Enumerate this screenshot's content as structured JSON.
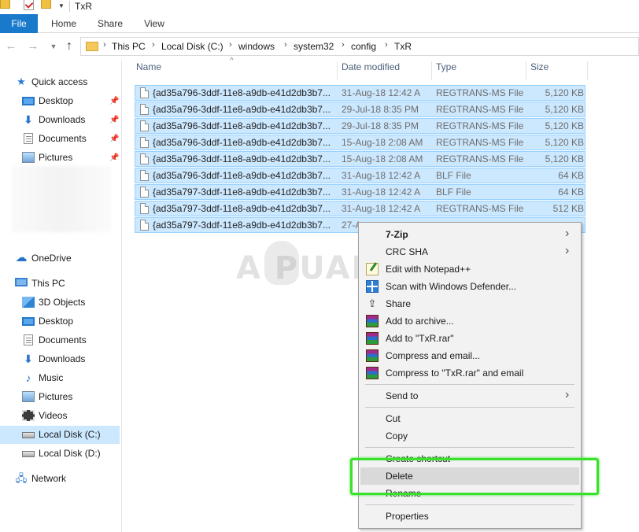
{
  "window": {
    "title": "TxR"
  },
  "ribbon": {
    "tabs": [
      "File",
      "Home",
      "Share",
      "View"
    ]
  },
  "address": {
    "parts": [
      "This PC",
      "Local Disk (C:)",
      "windows",
      "system32",
      "config",
      "TxR"
    ]
  },
  "nav": {
    "quick_access": "Quick access",
    "quick_items": [
      "Desktop",
      "Downloads",
      "Documents",
      "Pictures"
    ],
    "onedrive": "OneDrive",
    "this_pc": "This PC",
    "pc_items": [
      "3D Objects",
      "Desktop",
      "Documents",
      "Downloads",
      "Music",
      "Pictures",
      "Videos",
      "Local Disk (C:)",
      "Local Disk (D:)"
    ],
    "network": "Network"
  },
  "list": {
    "headers": {
      "name": "Name",
      "date": "Date modified",
      "type": "Type",
      "size": "Size"
    },
    "rows": [
      {
        "name": "{ad35a796-3ddf-11e8-a9db-e41d2db3b7...",
        "date": "31-Aug-18 12:42 A",
        "type": "REGTRANS-MS File",
        "size": "5,120 KB"
      },
      {
        "name": "{ad35a796-3ddf-11e8-a9db-e41d2db3b7...",
        "date": "29-Jul-18 8:35 PM",
        "type": "REGTRANS-MS File",
        "size": "5,120 KB"
      },
      {
        "name": "{ad35a796-3ddf-11e8-a9db-e41d2db3b7...",
        "date": "29-Jul-18 8:35 PM",
        "type": "REGTRANS-MS File",
        "size": "5,120 KB"
      },
      {
        "name": "{ad35a796-3ddf-11e8-a9db-e41d2db3b7...",
        "date": "15-Aug-18 2:08 AM",
        "type": "REGTRANS-MS File",
        "size": "5,120 KB"
      },
      {
        "name": "{ad35a796-3ddf-11e8-a9db-e41d2db3b7...",
        "date": "15-Aug-18 2:08 AM",
        "type": "REGTRANS-MS File",
        "size": "5,120 KB"
      },
      {
        "name": "{ad35a796-3ddf-11e8-a9db-e41d2db3b7...",
        "date": "31-Aug-18 12:42 A",
        "type": "BLF File",
        "size": "64 KB"
      },
      {
        "name": "{ad35a797-3ddf-11e8-a9db-e41d2db3b7...",
        "date": "31-Aug-18 12:42 A",
        "type": "BLF File",
        "size": "64 KB"
      },
      {
        "name": "{ad35a797-3ddf-11e8-a9db-e41d2db3b7...",
        "date": "31-Aug-18 12:42 A",
        "type": "REGTRANS-MS File",
        "size": "512 KB"
      },
      {
        "name": "{ad35a797-3ddf-11e8-a9db-e41d2db3b7...",
        "date": "27-A",
        "type": "",
        "size": ""
      }
    ]
  },
  "context_menu": {
    "items": [
      {
        "label": "7-Zip",
        "bold": true,
        "submenu": true,
        "icon": ""
      },
      {
        "label": "CRC SHA",
        "submenu": true,
        "icon": ""
      },
      {
        "label": "Edit with Notepad++",
        "icon": "notepadpp-icon"
      },
      {
        "label": "Scan with Windows Defender...",
        "icon": "defender-icon"
      },
      {
        "label": "Share",
        "icon": "share-icon"
      },
      {
        "label": "Add to archive...",
        "icon": "winrar-icon"
      },
      {
        "label": "Add to \"TxR.rar\"",
        "icon": "winrar-icon"
      },
      {
        "label": "Compress and email...",
        "icon": "winrar-icon"
      },
      {
        "label": "Compress to \"TxR.rar\" and email",
        "icon": "winrar-icon"
      },
      {
        "label": "Send to",
        "submenu": true,
        "icon": ""
      },
      {
        "label": "Cut",
        "icon": ""
      },
      {
        "label": "Copy",
        "icon": ""
      },
      {
        "label": "Create shortcut",
        "icon": ""
      },
      {
        "label": "Delete",
        "icon": "",
        "hover": true
      },
      {
        "label": "Rename",
        "icon": ""
      },
      {
        "label": "Properties",
        "icon": ""
      }
    ]
  },
  "watermark": {
    "text": "A  PUALS"
  },
  "colors": {
    "selection": "#cce8ff",
    "selection_border": "#99d1ff",
    "file_tab": "#1979ca",
    "highlight": "#39e02c"
  }
}
